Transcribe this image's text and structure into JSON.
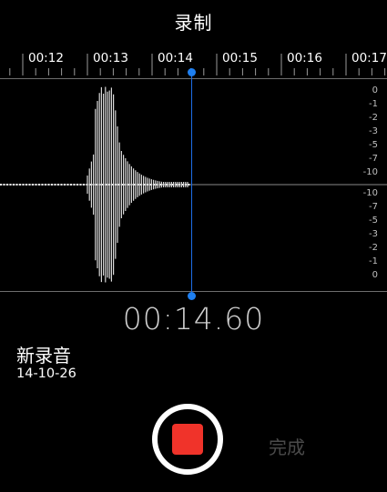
{
  "header": {
    "title": "录制"
  },
  "timeline": {
    "labels": [
      "00:12",
      "00:13",
      "00:14",
      "00:15",
      "00:16",
      "00:17"
    ]
  },
  "waveform": {
    "db_scale_top": [
      "0",
      "-1",
      "-2",
      "-3",
      "-5",
      "-7",
      "-10"
    ],
    "db_scale_bottom": [
      "-10",
      "-7",
      "-5",
      "-3",
      "-2",
      "-1",
      "0"
    ]
  },
  "recording": {
    "elapsed": "00:14.60",
    "name": "新录音",
    "date": "14-10-26"
  },
  "controls": {
    "done_label": "完成"
  },
  "colors": {
    "background": "#000000",
    "playhead": "#1e7ff0",
    "stop": "#f0332a",
    "done_disabled": "#4a4a4a"
  }
}
